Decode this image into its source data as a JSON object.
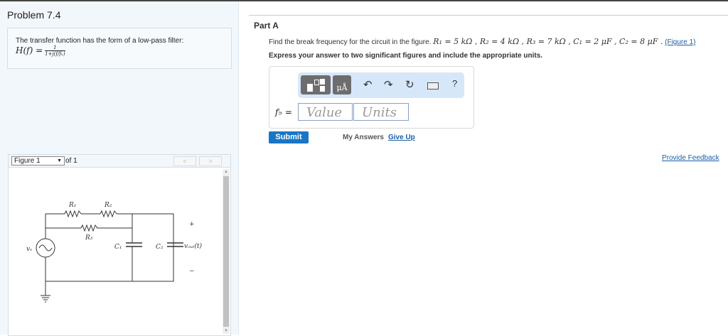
{
  "problem": {
    "title": "Problem 7.4",
    "tf_text": "The transfer function has the form of a low-pass filter:",
    "tf_lhs": "H(f) =",
    "tf_num": "1",
    "tf_den": "1+j(f/fₕ)"
  },
  "figure": {
    "select": "Figure 1",
    "of": "of 1",
    "prev": "<",
    "next": ">",
    "labels": {
      "r1": "R₁",
      "r2": "R₂",
      "r3": "R₃",
      "c1": "C₁",
      "c2": "C₂",
      "vs": "vₛ",
      "vout": "vₒᵤₜ(t)",
      "plus": "+",
      "minus": "−"
    }
  },
  "part": {
    "title": "Part A",
    "question": "Find the break frequency for the circuit in the figure.",
    "params": "R₁ = 5 kΩ , R₂ = 4 kΩ , R₃ = 7 kΩ , C₁ = 2 μF , C₂ = 8 μF .",
    "figure_link": "(Figure 1)",
    "instructions": "Express your answer to two significant figures and include the appropriate units.",
    "toolbar": {
      "units_btn": "μÅ",
      "undo": "↶",
      "redo": "↷",
      "reset": "↻",
      "help": "?"
    },
    "answer_label": "f♭ =",
    "value_placeholder": "Value",
    "units_placeholder": "Units",
    "submit": "Submit",
    "my_answers": "My Answers",
    "give_up": "Give Up"
  },
  "feedback": "Provide Feedback"
}
